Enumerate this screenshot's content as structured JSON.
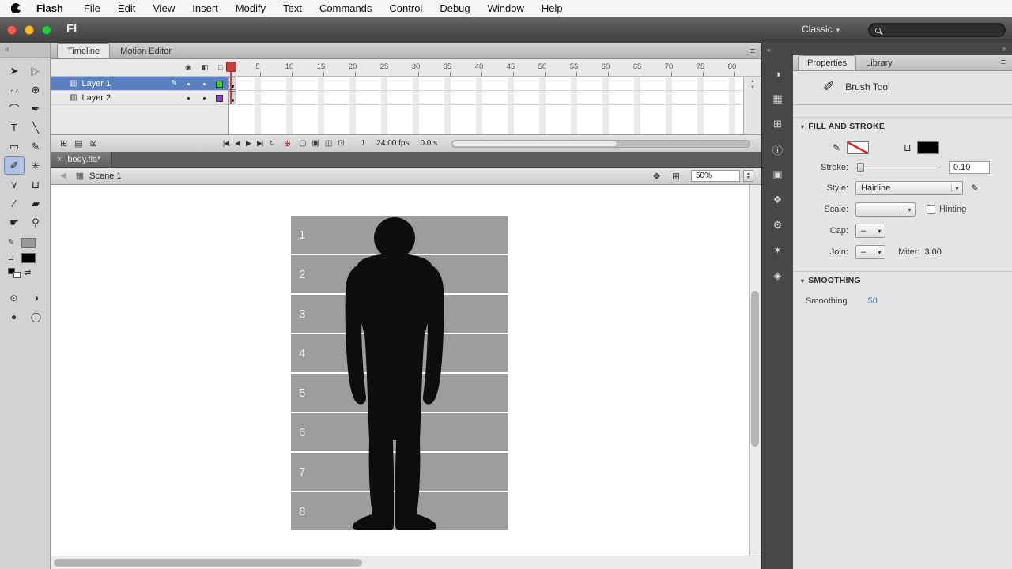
{
  "glyphs": {
    "collapse_left": "«",
    "collapse_right": "»",
    "panel_menu": "≡",
    "dd_arrow": "▾",
    "close": "×",
    "step_up": "▲",
    "step_down": "▼",
    "section_triangle": "▾"
  },
  "menubar": {
    "app_name": "Flash",
    "items": [
      "File",
      "Edit",
      "View",
      "Insert",
      "Modify",
      "Text",
      "Commands",
      "Control",
      "Debug",
      "Window",
      "Help"
    ]
  },
  "titlebar": {
    "logo": "Fl",
    "workspace": "Classic"
  },
  "toolbar": {
    "tools": [
      {
        "name": "selection",
        "glyph": "➤"
      },
      {
        "name": "subselection",
        "glyph": "▷"
      },
      {
        "name": "free-transform",
        "glyph": "▱"
      },
      {
        "name": "3d-rotation",
        "glyph": "⊕"
      },
      {
        "name": "lasso",
        "glyph": "⌒"
      },
      {
        "name": "pen",
        "glyph": "✒"
      },
      {
        "name": "text",
        "glyph": "T"
      },
      {
        "name": "line",
        "glyph": "╲"
      },
      {
        "name": "rectangle",
        "glyph": "▭"
      },
      {
        "name": "pencil",
        "glyph": "✎"
      },
      {
        "name": "brush",
        "glyph": "✐"
      },
      {
        "name": "deco",
        "glyph": "✳"
      },
      {
        "name": "bone",
        "glyph": "⋎"
      },
      {
        "name": "paint-bucket",
        "glyph": "⊔"
      },
      {
        "name": "eyedropper",
        "glyph": "∕"
      },
      {
        "name": "eraser",
        "glyph": "▰"
      },
      {
        "name": "hand",
        "glyph": "☛"
      },
      {
        "name": "zoom",
        "glyph": "⚲"
      }
    ],
    "stroke_color": "#9a9a9a",
    "fill_color": "#000000",
    "swap_glyph": "⇄",
    "options": [
      "⊙",
      "◑",
      "●",
      "◯"
    ]
  },
  "timeline": {
    "tabs": [
      "Timeline",
      "Motion Editor"
    ],
    "header_icons": {
      "visibility": "◉",
      "lock": "◧",
      "outline": "□"
    },
    "layers": [
      {
        "name": "Layer 1",
        "type_icon": "▥",
        "edit_icon": "✎",
        "outline_color": "#35d435"
      },
      {
        "name": "Layer 2",
        "type_icon": "▥",
        "outline_color": "#8b3fc9"
      }
    ],
    "ruler": [
      "5",
      "10",
      "15",
      "20",
      "25",
      "30",
      "35",
      "40",
      "45",
      "50",
      "55",
      "60",
      "65",
      "70",
      "75",
      "80"
    ],
    "controls": {
      "new_layer": "⊞",
      "new_folder": "▤",
      "delete": "⊠",
      "first": "|◀",
      "prev": "◀",
      "play": "▶",
      "next": "▶|",
      "loop": "↻",
      "center_frame": "⊕",
      "onion": [
        "▢",
        "▣",
        "◫",
        "⊡"
      ],
      "current_frame": "1",
      "fps": "24.00 fps",
      "elapsed": "0.0 s"
    }
  },
  "document": {
    "tab_title": "body.fla*",
    "scene": "Scene 1",
    "zoom": "50%",
    "back_icon": "◀",
    "scene_icon": "▦",
    "edit_scene_icon": "❖",
    "edit_symbols_icon": "⊞"
  },
  "stage": {
    "rows": [
      "1",
      "2",
      "3",
      "4",
      "5",
      "6",
      "7",
      "8"
    ],
    "band_color": "#9d9d9d",
    "figure": "human-silhouette"
  },
  "dock": {
    "items": [
      {
        "name": "color",
        "glyph": "◑"
      },
      {
        "name": "swatches",
        "glyph": "▦"
      },
      {
        "name": "align",
        "glyph": "⊞"
      },
      {
        "name": "info",
        "glyph": "ⓘ"
      },
      {
        "name": "transform",
        "glyph": "▣"
      },
      {
        "name": "code-snippets",
        "glyph": "❖"
      },
      {
        "name": "components",
        "glyph": "⚙"
      },
      {
        "name": "motion-presets",
        "glyph": "✶"
      },
      {
        "name": "project",
        "glyph": "◈"
      }
    ]
  },
  "properties": {
    "tabs": [
      "Properties",
      "Library"
    ],
    "tool_icon": "✐",
    "tool_name": "Brush Tool",
    "sections": {
      "fill_stroke": "FILL AND STROKE",
      "smoothing": "SMOOTHING"
    },
    "stroke_icon": "✎",
    "fill_icon": "⊔",
    "edit_style_icon": "✎",
    "labels": {
      "stroke": "Stroke:",
      "style": "Style:",
      "scale": "Scale:",
      "cap": "Cap:",
      "join": "Join:",
      "miter": "Miter:",
      "hinting": "Hinting",
      "smoothing": "Smoothing"
    },
    "values": {
      "stroke": "0.10",
      "style": "Hairline",
      "scale": "",
      "cap": "–",
      "join": "–",
      "miter": "3.00",
      "smoothing": "50"
    }
  }
}
